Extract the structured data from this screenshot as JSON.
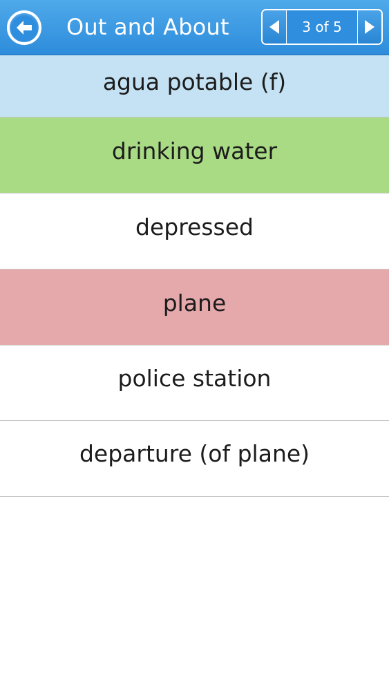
{
  "header": {
    "title": "Out and About",
    "pager_label": "3 of 5",
    "back_icon": "back-arrow-icon",
    "prev_icon": "arrow-left-icon",
    "next_icon": "arrow-right-icon"
  },
  "quiz": {
    "question": "agua potable (f)",
    "answers": [
      {
        "label": "drinking water",
        "state": "correct"
      },
      {
        "label": "depressed",
        "state": "neutral"
      },
      {
        "label": "plane",
        "state": "incorrect"
      },
      {
        "label": "police station",
        "state": "neutral"
      },
      {
        "label": "departure (of plane)",
        "state": "neutral"
      }
    ]
  },
  "colors": {
    "header": "#2d8cdb",
    "question_bg": "#c4e2f3",
    "correct_bg": "#a9da84",
    "incorrect_bg": "#e6a9ab",
    "neutral_bg": "#ffffff"
  }
}
